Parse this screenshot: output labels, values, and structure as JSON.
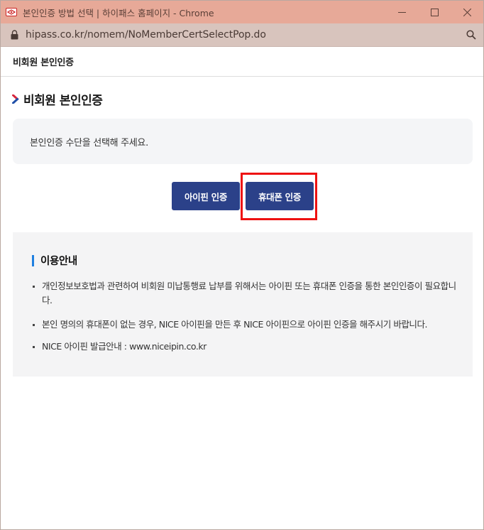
{
  "browser": {
    "window_title": "본인인증 방법 선택 | 하이패스 홈페이지 - Chrome",
    "url": "hipass.co.kr/nomem/NoMemberCertSelectPop.do",
    "icons": [
      "favicon-icon",
      "minimize-icon",
      "maximize-icon",
      "close-icon",
      "lock-icon",
      "zoom-icon"
    ]
  },
  "popup": {
    "header_title": "비회원 본인인증",
    "page_title": "비회원 본인인증",
    "notice": "본인인증 수단을 선택해 주세요.",
    "buttons": {
      "ipin": "아이핀 인증",
      "phone": "휴대폰 인증"
    },
    "guide": {
      "title": "이용안내",
      "items": [
        "개인정보보호법과 관련하여 비회원 미납통행료 납부를 위해서는 아이핀 또는 휴대폰 인증을 통한 본인인증이 필요합니다.",
        "본인 명의의 휴대폰이 없는 경우, NICE 아이핀을 만든 후 NICE 아이핀으로 아이핀 인증을 해주시기 바랍니다.",
        "NICE 아이핀 발급안내 : www.niceipin.co.kr"
      ]
    }
  },
  "colors": {
    "titlebar": "#e7a998",
    "addressbar": "#d8c4bd",
    "button": "#2b4189",
    "highlight": "#ee1111",
    "guide_bar": "#1f7fe0",
    "chevron_red": "#d7263d",
    "chevron_blue": "#1f4fa8"
  }
}
